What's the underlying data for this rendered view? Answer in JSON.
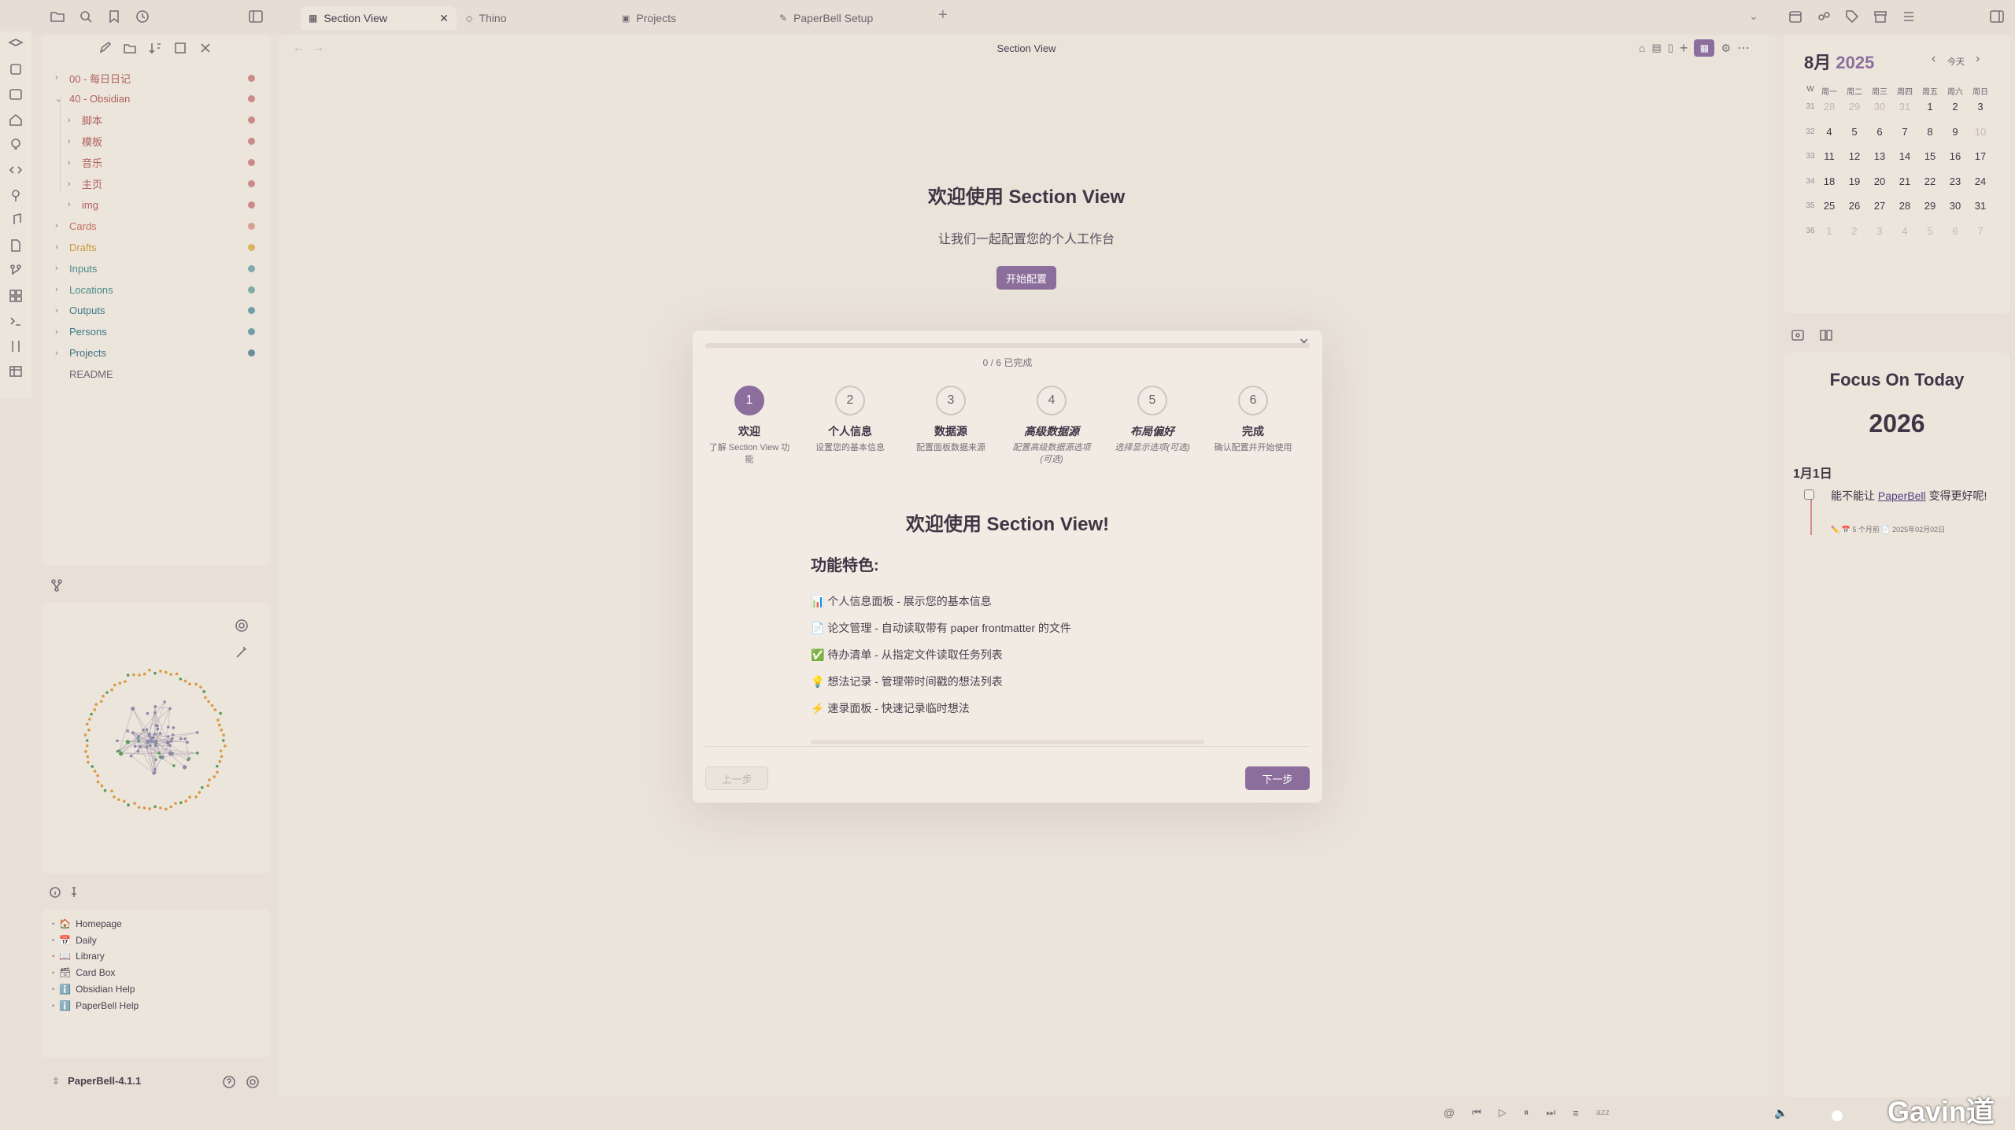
{
  "tabs": [
    {
      "label": "Section View",
      "active": true
    },
    {
      "label": "Thino"
    },
    {
      "label": "Projects"
    },
    {
      "label": "PaperBell Setup"
    }
  ],
  "main_title": "Section View",
  "sidebar": {
    "items": [
      {
        "label": "00 - 每日日记",
        "color": "#b0605c",
        "dot": "#c98a88"
      },
      {
        "label": "40 - Obsidian",
        "color": "#b0605c",
        "dot": "#c98a88",
        "open": true
      },
      {
        "label": "脚本",
        "color": "#b0605c",
        "dot": "#c98a88"
      },
      {
        "label": "模板",
        "color": "#b0605c",
        "dot": "#c98a88"
      },
      {
        "label": "音乐",
        "color": "#b0605c",
        "dot": "#c98a88"
      },
      {
        "label": "主页",
        "color": "#b0605c",
        "dot": "#c98a88"
      },
      {
        "label": "img",
        "color": "#b0605c",
        "dot": "#c98a88"
      },
      {
        "label": "Cards",
        "color": "#c2735c",
        "dot": "#d6a18e"
      },
      {
        "label": "Drafts",
        "color": "#c99b3e",
        "dot": "#d9b35e"
      },
      {
        "label": "Inputs",
        "color": "#4e8a8c",
        "dot": "#7fabab"
      },
      {
        "label": "Locations",
        "color": "#4e8a8c",
        "dot": "#7fabab"
      },
      {
        "label": "Outputs",
        "color": "#3e7a86",
        "dot": "#6f9ea6"
      },
      {
        "label": "Persons",
        "color": "#3e7a86",
        "dot": "#6f9ea6"
      },
      {
        "label": "Projects",
        "color": "#3e6e7e",
        "dot": "#6b8f9a"
      },
      {
        "label": "README",
        "color": "#6e6470",
        "dot": ""
      }
    ]
  },
  "bookmarks": [
    {
      "icon": "🏠",
      "label": "Homepage"
    },
    {
      "icon": "📅",
      "label": "Daily"
    },
    {
      "icon": "📖",
      "label": "Library"
    },
    {
      "icon": "🗃",
      "label": "Card Box"
    },
    {
      "icon": "ℹ️",
      "label": "Obsidian Help"
    },
    {
      "icon": "ℹ️",
      "label": "PaperBell Help"
    }
  ],
  "vault_name": "PaperBell-4.1.1",
  "welcome": {
    "title": "欢迎使用 Section View",
    "subtitle": "让我们一起配置您的个人工作台",
    "start_button": "开始配置"
  },
  "modal": {
    "progress": "0 / 6 已完成",
    "progress_value": 0,
    "steps": [
      {
        "num": "1",
        "title": "欢迎",
        "desc": "了解 Section View 功能",
        "active": true
      },
      {
        "num": "2",
        "title": "个人信息",
        "desc": "设置您的基本信息"
      },
      {
        "num": "3",
        "title": "数据源",
        "desc": "配置面板数据来源"
      },
      {
        "num": "4",
        "title": "高级数据源",
        "desc": "配置高级数据源选项(可选)",
        "optional": true
      },
      {
        "num": "5",
        "title": "布局偏好",
        "desc": "选择显示选项(可选)",
        "optional": true
      },
      {
        "num": "6",
        "title": "完成",
        "desc": "确认配置并开始使用"
      }
    ],
    "heading": "欢迎使用 Section View!",
    "features_title": "功能特色:",
    "features": [
      "📊 个人信息面板 - 展示您的基本信息",
      "📄 论文管理 - 自动读取带有 paper frontmatter 的文件",
      "✅ 待办清单 - 从指定文件读取任务列表",
      "💡 想法记录 - 管理带时间戳的想法列表",
      "⚡ 速录面板 - 快速记录临时想法"
    ],
    "prev": "上一步",
    "next": "下一步"
  },
  "calendar": {
    "month": "8月",
    "year": "2025",
    "today": "今天",
    "headers": [
      "W",
      "周一",
      "周二",
      "周三",
      "周四",
      "周五",
      "周六",
      "周日"
    ],
    "weeks": [
      {
        "w": "31",
        "days": [
          "28",
          "29",
          "30",
          "31",
          "1",
          "2",
          "3"
        ],
        "dim": [
          0,
          1,
          2,
          3
        ]
      },
      {
        "w": "32",
        "days": [
          "4",
          "5",
          "6",
          "7",
          "8",
          "9",
          "10"
        ],
        "dim": [
          6
        ]
      },
      {
        "w": "33",
        "days": [
          "11",
          "12",
          "13",
          "14",
          "15",
          "16",
          "17"
        ],
        "dim": []
      },
      {
        "w": "34",
        "days": [
          "18",
          "19",
          "20",
          "21",
          "22",
          "23",
          "24"
        ],
        "dim": []
      },
      {
        "w": "35",
        "days": [
          "25",
          "26",
          "27",
          "28",
          "29",
          "30",
          "31"
        ],
        "dim": []
      },
      {
        "w": "36",
        "days": [
          "1",
          "2",
          "3",
          "4",
          "5",
          "6",
          "7"
        ],
        "dim": [
          0,
          1,
          2,
          3,
          4,
          5,
          6
        ]
      }
    ]
  },
  "focus": {
    "title": "Focus On Today",
    "year": "2026",
    "date": "1月1日",
    "task_text": "能不能让 ",
    "task_link": "PaperBell",
    "task_text2": " 变得更好呢!",
    "task_meta": "✏️ 📅 5 个月前  📄 2025年02月02日"
  },
  "statusbar": {
    "kbd": "azz"
  },
  "watermark": "Gavin道"
}
